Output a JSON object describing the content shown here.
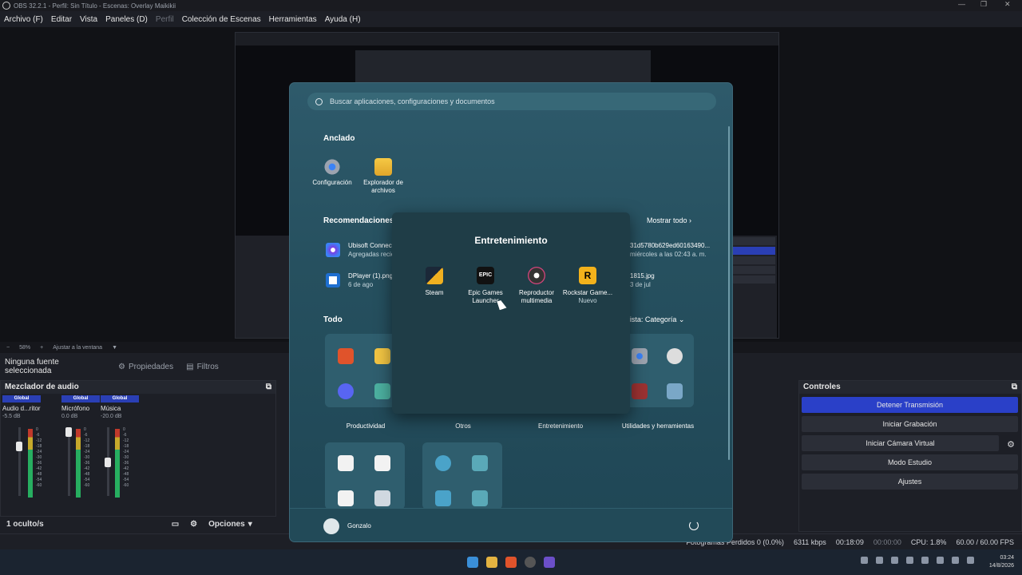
{
  "window": {
    "title": "OBS 32.2.1 - Perfil: Sin Título - Escenas: Overlay Maikikii"
  },
  "menu": [
    "Archivo (F)",
    "Editar",
    "Vista",
    "Paneles (D)",
    "Perfil",
    "Colección de Escenas",
    "Herramientas",
    "Ayuda (H)"
  ],
  "zoom": {
    "value": "58%",
    "fit": "Ajustar a la ventana"
  },
  "sources_bar": {
    "no_source": "Ninguna fuente seleccionada",
    "properties": "Propiedades",
    "filters": "Filtros"
  },
  "mixer": {
    "title": "Mezclador de audio",
    "channels": [
      {
        "scope": "Global",
        "name": "Audio d...ritorio",
        "db": "-5.5 dB",
        "level": 0.74
      },
      {
        "scope": "Global",
        "name": "Micrófono",
        "db": "0.0 dB",
        "level": 1.0
      },
      {
        "scope": "Global",
        "name": "Música",
        "db": "-20.0 dB",
        "level": 0.45
      }
    ],
    "scale": [
      "0",
      "-6",
      "-12",
      "-18",
      "-24",
      "-30",
      "-36",
      "-42",
      "-48",
      "-54",
      "-60"
    ],
    "footer_label": "1 oculto/s",
    "options": "Opciones"
  },
  "controls": {
    "title": "Controles",
    "buttons": [
      "Detener Transmisión",
      "Iniciar Grabación",
      "Iniciar Cámara Virtual",
      "Modo Estudio",
      "Ajustes"
    ]
  },
  "status": {
    "dropped": "Fotogramas Perdidos 0 (0.0%)",
    "bitrate": "6311 kbps",
    "stream_time": "00:18:09",
    "rec_time": "00:00:00",
    "cpu": "CPU: 1.8%",
    "fps": "60.00 / 60.00 FPS"
  },
  "start_menu": {
    "search_placeholder": "Buscar aplicaciones, configuraciones y documentos",
    "pinned_title": "Anclado",
    "pinned": [
      {
        "label": "Configuración",
        "icon": "gear-icon"
      },
      {
        "label": "Explorador de archivos",
        "icon": "folder-icon"
      }
    ],
    "recommended_title": "Recomendaciones",
    "show_all": "Mostrar todo",
    "recommended": [
      {
        "name": "Ubisoft Connect",
        "sub": "Agregadas recientemente"
      },
      {
        "name": "DPlayer (1).png",
        "sub": "6 de ago"
      },
      {
        "name": "31d5780b629ed60163490...",
        "sub": "miércoles a las 02:43 a. m."
      },
      {
        "name": "1815.jpg",
        "sub": "3 de jul"
      }
    ],
    "all_title": "Todo",
    "view_by": "Vista: Categoría",
    "categories": [
      "Productividad",
      "Otros",
      "Entretenimiento",
      "Utilidades y herramientas"
    ],
    "user": "Gonzalo"
  },
  "folder_popup": {
    "title": "Entretenimiento",
    "apps": [
      {
        "label": "Steam",
        "sub": ""
      },
      {
        "label": "Epic Games Launcher",
        "sub": ""
      },
      {
        "label": "Reproductor multimedia",
        "sub": ""
      },
      {
        "label": "Rockstar Game...",
        "sub": "Nuevo"
      }
    ]
  },
  "taskbar": {
    "time": "03:24",
    "date": "14/8/2026"
  }
}
